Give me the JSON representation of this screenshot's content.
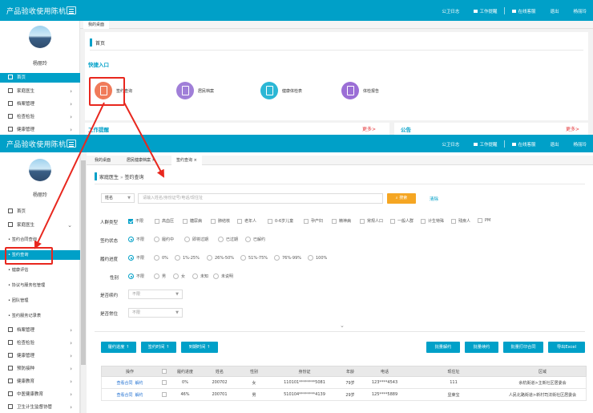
{
  "app": {
    "title": "产品验收使用陈杭",
    "nav": [
      "公卫日志",
      "工作提醒",
      "在线客服",
      "退出",
      "杨丽玲"
    ]
  },
  "user": {
    "name": "杨丽玲"
  },
  "screen1": {
    "sidebar": {
      "items": [
        {
          "label": "首页",
          "active": true
        },
        {
          "label": "家庭医生",
          "chevron": true
        },
        {
          "label": "档案管理",
          "chevron": true
        },
        {
          "label": "检查检验",
          "chevron": true
        },
        {
          "label": "健康管理",
          "chevron": true
        }
      ]
    },
    "tabs": [
      "我的桌面"
    ],
    "breadcrumb": "首页",
    "quick_entry_title": "快捷入口",
    "quick_items": [
      {
        "label": "签约查询",
        "icon": "contract-query-icon",
        "color": "#f07b5a"
      },
      {
        "label": "居民档案",
        "icon": "resident-file-icon",
        "color": "#a07fd8"
      },
      {
        "label": "健康体检表",
        "icon": "health-check-icon",
        "color": "#2bb7d5"
      },
      {
        "label": "体检报告",
        "icon": "exam-report-icon",
        "color": "#9b6ed6"
      }
    ],
    "work_reminder_title": "工作提醒",
    "notice_title": "公告",
    "more_label": "更多>"
  },
  "screen2": {
    "sidebar": {
      "items": [
        {
          "label": "首页"
        },
        {
          "label": "家庭医生",
          "chevron": true
        },
        {
          "label": "档案管理",
          "chevron": true
        },
        {
          "label": "检查检验",
          "chevron": true
        },
        {
          "label": "健康管理",
          "chevron": true
        },
        {
          "label": "预防接种",
          "chevron": true
        },
        {
          "label": "健康教育",
          "chevron": true
        },
        {
          "label": "中医健康教育",
          "chevron": true
        },
        {
          "label": "卫生计生监督协管",
          "chevron": true
        }
      ],
      "submenu": [
        {
          "label": "• 签约合同查询",
          "active": false
        },
        {
          "label": "• 签约查询",
          "active": true
        },
        {
          "label": "• 健康评估",
          "active": false
        },
        {
          "label": "• 协议与服务包管理",
          "active": false
        },
        {
          "label": "• 团队管理",
          "active": false
        },
        {
          "label": "• 签约服务记录表",
          "active": false
        }
      ]
    },
    "tabs": [
      "我的桌面",
      "居民健康档案 ×",
      "签约查询 ×"
    ],
    "breadcrumb": {
      "section": "家庭医生",
      "separator": "»",
      "page": "签约查询"
    },
    "search": {
      "field_select": "姓名",
      "placeholder": "请输入姓名/身份证号/电话/现住址",
      "search_button": "搜索",
      "clear_link": "清除"
    },
    "filters": {
      "population": {
        "label": "人群类型",
        "options": [
          {
            "label": "不限",
            "checked": true
          },
          {
            "label": "高血压",
            "checked": false
          },
          {
            "label": "糖尿病",
            "checked": false
          },
          {
            "label": "肺结核",
            "checked": false
          },
          {
            "label": "老年人",
            "checked": false
          },
          {
            "label": "0-6岁儿童",
            "checked": false
          },
          {
            "label": "孕产妇",
            "checked": false
          },
          {
            "label": "精神病",
            "checked": false
          },
          {
            "label": "常规人口",
            "checked": false
          },
          {
            "label": "一般人群",
            "checked": false
          },
          {
            "label": "计生特殊",
            "checked": false
          },
          {
            "label": "残疾人",
            "checked": false
          },
          {
            "label": "PM",
            "checked": false
          }
        ]
      },
      "sign_status": {
        "label": "签约状态",
        "options": [
          {
            "label": "不限",
            "checked": true
          },
          {
            "label": "履约中",
            "checked": false
          },
          {
            "label": "即将过期",
            "checked": false
          },
          {
            "label": "已过期",
            "checked": false
          },
          {
            "label": "已解约",
            "checked": false
          }
        ]
      },
      "progress": {
        "label": "履约进度",
        "options": [
          {
            "label": "不限",
            "checked": true
          },
          {
            "label": "0%",
            "checked": false
          },
          {
            "label": "1%-25%",
            "checked": false
          },
          {
            "label": "26%-50%",
            "checked": false
          },
          {
            "label": "51%-75%",
            "checked": false
          },
          {
            "label": "76%-99%",
            "checked": false
          },
          {
            "label": "100%",
            "checked": false
          }
        ]
      },
      "gender": {
        "label": "性别",
        "options": [
          {
            "label": "不限",
            "checked": true
          },
          {
            "label": "男",
            "checked": false
          },
          {
            "label": "女",
            "checked": false
          },
          {
            "label": "未知",
            "checked": false
          },
          {
            "label": "未说明",
            "checked": false
          }
        ]
      },
      "renewal": {
        "label": "是否续约",
        "value": "不限"
      },
      "resident": {
        "label": "是否常住",
        "value": "不限"
      }
    },
    "actions_left": [
      "履约进度 ↑",
      "签约时间 ↑",
      "到期时间 ↑"
    ],
    "actions_right": [
      "批量解约",
      "批量续约",
      "批量打印合同",
      "导出Excel"
    ],
    "table": {
      "headers": [
        "操作",
        "",
        "履约进度",
        "姓名",
        "性别",
        "身份证",
        "年龄",
        "电话",
        "现住址",
        "区域"
      ],
      "rows": [
        {
          "actions": [
            "查看合同",
            "解约"
          ],
          "progress": "0%",
          "name": "200702",
          "gender": "女",
          "id": "110101********5081",
          "age": "79岁",
          "phone": "123****4543",
          "address": "111",
          "region": "余杭街道>主新社区居委会"
        },
        {
          "actions": [
            "查看合同",
            "解约"
          ],
          "progress": "46%",
          "name": "200701",
          "gender": "男",
          "id": "510104********4139",
          "age": "29岁",
          "phone": "125****5889",
          "address": "显莱宝",
          "region": "人民北路街道>新村司法街社区居委会"
        }
      ]
    }
  },
  "colors": {
    "primary": "#00a0c8",
    "annotation": "#e8271e",
    "search_button": "#f5a623",
    "link": "#1f6fd1"
  }
}
